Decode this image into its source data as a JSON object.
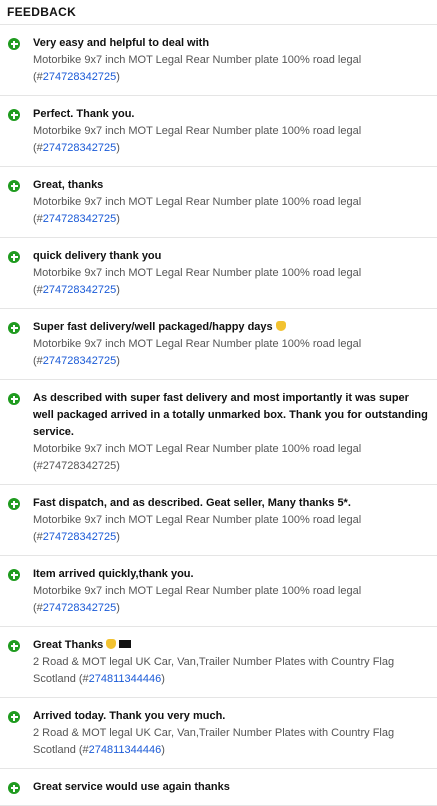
{
  "header": {
    "title": "FEEDBACK"
  },
  "items": [
    {
      "comment": "Very easy and helpful to deal with",
      "product_prefix": "Motorbike 9x7 inch MOT Legal Rear Number plate 100% road legal (#",
      "item_number": "274728342725",
      "product_suffix": ")",
      "link": true
    },
    {
      "comment": "Perfect. Thank you.",
      "product_prefix": "Motorbike 9x7 inch MOT Legal Rear Number plate 100% road legal (#",
      "item_number": "274728342725",
      "product_suffix": ")",
      "link": true
    },
    {
      "comment": "Great, thanks",
      "product_prefix": "Motorbike 9x7 inch MOT Legal Rear Number plate 100% road legal (#",
      "item_number": "274728342725",
      "product_suffix": ")",
      "link": true
    },
    {
      "comment": "quick delivery thank you",
      "product_prefix": "Motorbike 9x7 inch MOT Legal Rear Number plate 100% road legal (#",
      "item_number": "274728342725",
      "product_suffix": ")",
      "link": true
    },
    {
      "comment": "Super fast delivery/well packaged/happy days",
      "emoji": "thumbs-up",
      "product_prefix": "Motorbike 9x7 inch MOT Legal Rear Number plate 100% road legal (#",
      "item_number": "274728342725",
      "product_suffix": ")",
      "link": true
    },
    {
      "comment": "As described with super fast delivery and most importantly it was super well packaged arrived in a totally unmarked box. Thank you for outstanding service.",
      "product_prefix": "Motorbike 9x7 inch MOT Legal Rear Number plate 100% road legal (#",
      "item_number": "274728342725",
      "product_suffix": ")",
      "link": false
    },
    {
      "comment": "Fast dispatch, and as described. Geat seller, Many thanks 5*.",
      "product_prefix": "Motorbike 9x7 inch MOT Legal Rear Number plate 100% road legal (#",
      "item_number": "274728342725",
      "product_suffix": ")",
      "link": true
    },
    {
      "comment": "Item arrived quickly,thank you.",
      "product_prefix": "Motorbike 9x7 inch MOT Legal Rear Number plate 100% road legal (#",
      "item_number": "274728342725",
      "product_suffix": ")",
      "link": true
    },
    {
      "comment": "Great Thanks",
      "emoji": "thumbs-up-flag",
      "product_prefix": "2 Road & MOT legal UK Car, Van,Trailer Number Plates with Country Flag Scotland (#",
      "item_number": "274811344446",
      "product_suffix": ")",
      "link": true
    },
    {
      "comment": "Arrived today. Thank you very much.",
      "product_prefix": "2 Road & MOT legal UK Car, Van,Trailer Number Plates with Country Flag Scotland (#",
      "item_number": "274811344446",
      "product_suffix": ")",
      "link": true
    },
    {
      "comment": "Great service would use again thanks",
      "product_prefix": "",
      "item_number": "",
      "product_suffix": "",
      "link": false
    }
  ],
  "icon_name": "plus-circle-icon",
  "colors": {
    "positive": "#1f9b1f",
    "link": "#1a5ad7",
    "text_secondary": "#555555"
  }
}
